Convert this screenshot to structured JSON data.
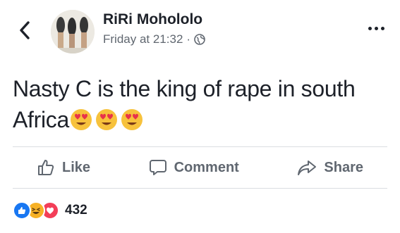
{
  "post": {
    "author": "RiRi Mohololo",
    "timestamp": "Friday at 21:32",
    "separator": "·",
    "text": "Nasty C is the king of rape in south Africa",
    "emojis": [
      "heart-eyes-emoji",
      "heart-eyes-emoji",
      "heart-eyes-emoji"
    ]
  },
  "actions": {
    "like": "Like",
    "comment": "Comment",
    "share": "Share"
  },
  "reactions": {
    "types": [
      "like",
      "haha",
      "love"
    ],
    "count": "432"
  },
  "colors": {
    "like_blue": "#1877f2",
    "love_red": "#f33e58",
    "haha_yellow": "#f7b125",
    "muted_text": "#606770"
  }
}
